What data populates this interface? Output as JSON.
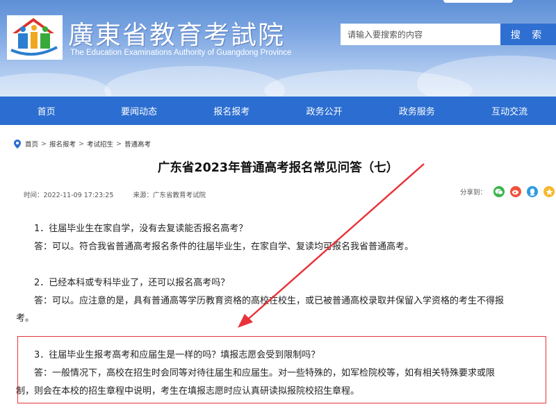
{
  "header": {
    "site_title": "廣東省教育考試院",
    "site_subtitle": "The Education Examinations Authority of Guangdong Province",
    "search_placeholder": "请输入要搜索的内容",
    "search_button": "搜 索"
  },
  "nav": {
    "items": [
      "首页",
      "要闻动态",
      "报名报考",
      "政务公开",
      "政务服务",
      "互动交流"
    ]
  },
  "breadcrumb": [
    "首页",
    "报名报考",
    "考试招生",
    "普通高考"
  ],
  "article": {
    "title": "广东省2023年普通高考报名常见问答（七）",
    "time": "时间：2022-11-09 17:23:25",
    "source": "来源：广东省教育考试院",
    "share_label": "分享到：",
    "q1": "1．往届毕业生在家自学，没有去复读能否报名高考？",
    "a1": "答：可以。符合我省普通高考报名条件的往届毕业生，在家自学、复读均可报名我省普通高考。",
    "q2": "2．已经本科或专科毕业了，还可以报名高考吗？",
    "a2_line1": "答：可以。应注意的是，具有普通高等学历教育资格的高校在校生，或已被普通高校录取并保留入学资格的考生不得报",
    "a2_line2": "考。",
    "q3": "3．往届毕业生报考高考和应届生是一样的吗？填报志愿会受到限制吗？",
    "a3_line1": "答：一般情况下，高校在招生时会同等对待往届生和应届生。对一些特殊的，如军检院校等，如有相关特殊要求或限",
    "a3_line2": "制，则会在本校的招生章程中说明，考生在填报志愿时应认真研读拟报院校招生章程。"
  },
  "colors": {
    "nav_blue": "#2b6dd0",
    "search_blue": "#2f6fd1",
    "highlight_red": "#e8333a"
  }
}
